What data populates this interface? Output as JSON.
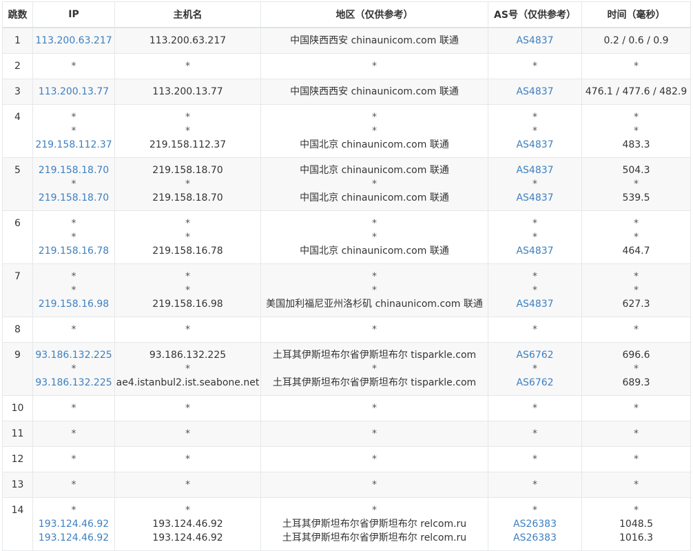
{
  "colors": {
    "link": "#3c7fc1",
    "border": "#e4e7ea",
    "alt_row": "#f8f8f8",
    "text": "#333333"
  },
  "headers": {
    "hop": "跳数",
    "ip": "IP",
    "host": "主机名",
    "region": "地区（仅供参考）",
    "as": "AS号（仅供参考）",
    "time": "时间（毫秒）"
  },
  "hops": [
    {
      "hop": "1",
      "ip": [
        "113.200.63.217"
      ],
      "host": [
        "113.200.63.217"
      ],
      "region": [
        "中国陕西西安 chinaunicom.com 联通"
      ],
      "as": [
        "AS4837"
      ],
      "time": [
        "0.2 / 0.6 / 0.9"
      ]
    },
    {
      "hop": "2",
      "ip": [
        "*"
      ],
      "host": [
        "*"
      ],
      "region": [
        "*"
      ],
      "as": [
        "*"
      ],
      "time": [
        "*"
      ]
    },
    {
      "hop": "3",
      "ip": [
        "113.200.13.77"
      ],
      "host": [
        "113.200.13.77"
      ],
      "region": [
        "中国陕西西安 chinaunicom.com 联通"
      ],
      "as": [
        "AS4837"
      ],
      "time": [
        "476.1 / 477.6 / 482.9"
      ]
    },
    {
      "hop": "4",
      "ip": [
        "*",
        "*",
        "219.158.112.37"
      ],
      "host": [
        "*",
        "*",
        "219.158.112.37"
      ],
      "region": [
        "*",
        "*",
        "中国北京 chinaunicom.com 联通"
      ],
      "as": [
        "*",
        "*",
        "AS4837"
      ],
      "time": [
        "*",
        "*",
        "483.3"
      ]
    },
    {
      "hop": "5",
      "ip": [
        "219.158.18.70",
        "*",
        "219.158.18.70"
      ],
      "host": [
        "219.158.18.70",
        "*",
        "219.158.18.70"
      ],
      "region": [
        "中国北京 chinaunicom.com 联通",
        "*",
        "中国北京 chinaunicom.com 联通"
      ],
      "as": [
        "AS4837",
        "*",
        "AS4837"
      ],
      "time": [
        "504.3",
        "*",
        "539.5"
      ]
    },
    {
      "hop": "6",
      "ip": [
        "*",
        "*",
        "219.158.16.78"
      ],
      "host": [
        "*",
        "*",
        "219.158.16.78"
      ],
      "region": [
        "*",
        "*",
        "中国北京 chinaunicom.com 联通"
      ],
      "as": [
        "*",
        "*",
        "AS4837"
      ],
      "time": [
        "*",
        "*",
        "464.7"
      ]
    },
    {
      "hop": "7",
      "ip": [
        "*",
        "*",
        "219.158.16.98"
      ],
      "host": [
        "*",
        "*",
        "219.158.16.98"
      ],
      "region": [
        "*",
        "*",
        "美国加利福尼亚州洛杉矶 chinaunicom.com 联通"
      ],
      "as": [
        "*",
        "*",
        "AS4837"
      ],
      "time": [
        "*",
        "*",
        "627.3"
      ]
    },
    {
      "hop": "8",
      "ip": [
        "*"
      ],
      "host": [
        "*"
      ],
      "region": [
        "*"
      ],
      "as": [
        "*"
      ],
      "time": [
        "*"
      ]
    },
    {
      "hop": "9",
      "ip": [
        "93.186.132.225",
        "*",
        "93.186.132.225"
      ],
      "host": [
        "93.186.132.225",
        "*",
        "ae4.istanbul2.ist.seabone.net"
      ],
      "region": [
        "土耳其伊斯坦布尔省伊斯坦布尔 tisparkle.com",
        "*",
        "土耳其伊斯坦布尔省伊斯坦布尔 tisparkle.com"
      ],
      "as": [
        "AS6762",
        "*",
        "AS6762"
      ],
      "time": [
        "696.6",
        "*",
        "689.3"
      ]
    },
    {
      "hop": "10",
      "ip": [
        "*"
      ],
      "host": [
        "*"
      ],
      "region": [
        "*"
      ],
      "as": [
        "*"
      ],
      "time": [
        "*"
      ]
    },
    {
      "hop": "11",
      "ip": [
        "*"
      ],
      "host": [
        "*"
      ],
      "region": [
        "*"
      ],
      "as": [
        "*"
      ],
      "time": [
        "*"
      ]
    },
    {
      "hop": "12",
      "ip": [
        "*"
      ],
      "host": [
        "*"
      ],
      "region": [
        "*"
      ],
      "as": [
        "*"
      ],
      "time": [
        "*"
      ]
    },
    {
      "hop": "13",
      "ip": [
        "*"
      ],
      "host": [
        "*"
      ],
      "region": [
        "*"
      ],
      "as": [
        "*"
      ],
      "time": [
        "*"
      ]
    },
    {
      "hop": "14",
      "ip": [
        "*",
        "193.124.46.92",
        "193.124.46.92"
      ],
      "host": [
        "*",
        "193.124.46.92",
        "193.124.46.92"
      ],
      "region": [
        "*",
        "土耳其伊斯坦布尔省伊斯坦布尔 relcom.ru",
        "土耳其伊斯坦布尔省伊斯坦布尔 relcom.ru"
      ],
      "as": [
        "*",
        "AS26383",
        "AS26383"
      ],
      "time": [
        "*",
        "1048.5",
        "1016.3"
      ]
    }
  ]
}
